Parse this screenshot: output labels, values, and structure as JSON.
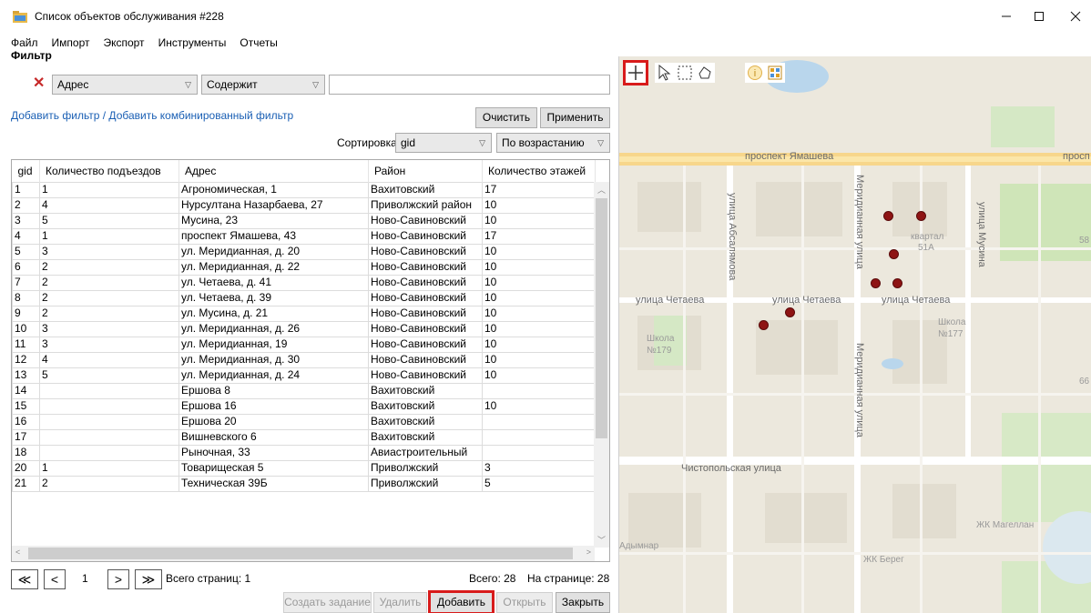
{
  "window": {
    "title": "Список объектов обслуживания #228"
  },
  "menu": [
    "Файл",
    "Импорт",
    "Экспорт",
    "Инструменты",
    "Отчеты"
  ],
  "filter": {
    "label": "Фильтр",
    "field": "Адрес",
    "condition": "Содержит",
    "value": "",
    "add_link": "Добавить фильтр / Добавить комбинированный фильтр",
    "clear_label": "Очистить",
    "apply_label": "Применить"
  },
  "sort": {
    "label": "Сортировка",
    "field": "gid",
    "order": "По возрастанию"
  },
  "table": {
    "columns": [
      "gid",
      "Количество подъездов",
      "Адрес",
      "Район",
      "Количество этажей"
    ],
    "rows": [
      [
        "1",
        "1",
        "Агрономическая, 1",
        "Вахитовский",
        "17"
      ],
      [
        "2",
        "4",
        "Нурсултана Назарбаева, 27",
        "Приволжский район",
        "10"
      ],
      [
        "3",
        "5",
        "Мусина, 23",
        "Ново-Савиновский",
        "10"
      ],
      [
        "4",
        "1",
        "проспект Ямашева, 43",
        "Ново-Савиновский",
        "17"
      ],
      [
        "5",
        "3",
        "ул. Меридианная, д. 20",
        "Ново-Савиновский",
        "10"
      ],
      [
        "6",
        "2",
        "ул. Меридианная, д. 22",
        "Ново-Савиновский",
        "10"
      ],
      [
        "7",
        "2",
        "ул. Четаева, д. 41",
        "Ново-Савиновский",
        "10"
      ],
      [
        "8",
        "2",
        "ул. Четаева, д. 39",
        "Ново-Савиновский",
        "10"
      ],
      [
        "9",
        "2",
        "ул. Мусина, д. 21",
        "Ново-Савиновский",
        "10"
      ],
      [
        "10",
        "3",
        "ул. Меридианная, д. 26",
        "Ново-Савиновский",
        "10"
      ],
      [
        "11",
        "3",
        "ул. Меридианная, 19",
        "Ново-Савиновский",
        "10"
      ],
      [
        "12",
        "4",
        "ул. Меридианная, д. 30",
        "Ново-Савиновский",
        "10"
      ],
      [
        "13",
        "5",
        "ул. Меридианная, д. 24",
        "Ново-Савиновский",
        "10"
      ],
      [
        "14",
        "",
        "Ершова 8",
        "Вахитовский",
        ""
      ],
      [
        "15",
        "",
        "Ершова 16",
        "Вахитовский",
        "10"
      ],
      [
        "16",
        "",
        "Ершова 20",
        "Вахитовский",
        ""
      ],
      [
        "17",
        "",
        "Вишневского 6",
        "Вахитовский",
        ""
      ],
      [
        "18",
        "",
        "Рыночная, 33",
        "Авиастроительный",
        ""
      ],
      [
        "20",
        "1",
        "Товарищеская 5",
        "Приволжский",
        "3"
      ],
      [
        "21",
        "2",
        "Техническая 39Б",
        "Приволжский",
        "5"
      ]
    ]
  },
  "pagination": {
    "first": "≪",
    "prev": "<",
    "current": "1",
    "next": ">",
    "last": "≫",
    "total_pages": "Всего страниц: 1",
    "total": "Всего: 28",
    "per_page": "На странице: 28"
  },
  "actions": {
    "create_task": "Создать задание",
    "delete": "Удалить",
    "add": "Добавить",
    "open": "Открыть",
    "close": "Закрыть"
  },
  "map": {
    "streets": {
      "yamasheva": "проспект Ямашева",
      "yamasheva2": "просп",
      "abzalova": "улица Абсалямова",
      "meridiannaya": "Меридианная улица",
      "meridiannaya2": "Меридианная улица",
      "musina": "улица Мусина",
      "chetaeva1": "улица Четаева",
      "chetaeva2": "улица Четаева",
      "chetaeva3": "улица Четаева",
      "chistopolskaya": "Чистопольская улица"
    },
    "pois": {
      "kvartal": "квартал",
      "kvartal_num": "51А",
      "school179": "Школа",
      "school179_num": "№179",
      "school177": "Школа",
      "school177_num": "№177",
      "magellan": "ЖК Магеллан",
      "adymnar": "Адымнар",
      "bereg": "ЖК Берег",
      "edge58": "58",
      "edge66": "66"
    }
  },
  "colors": {
    "marker": "#8e1414",
    "highlight": "#d81b1b",
    "link": "#1a5fb4"
  }
}
